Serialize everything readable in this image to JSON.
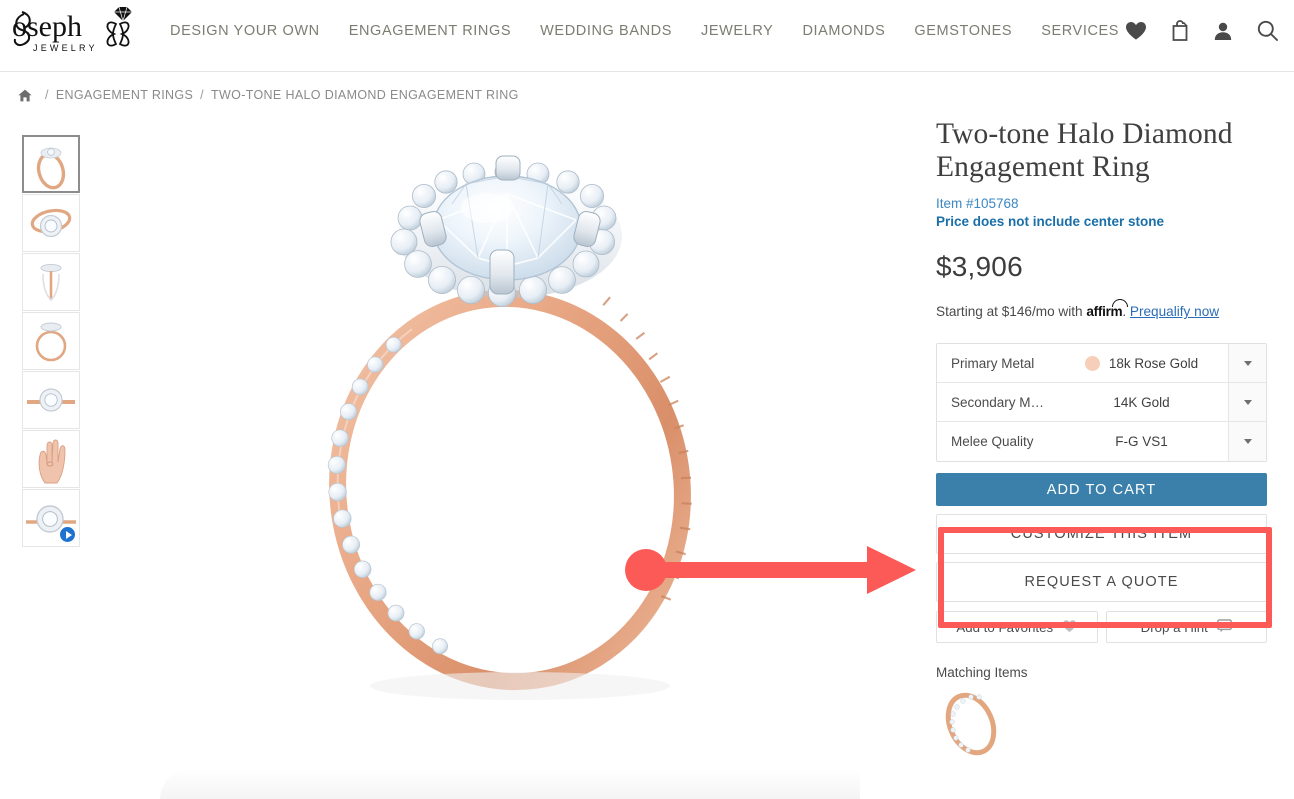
{
  "header": {
    "logo": {
      "name": "Joseph",
      "sub": "J E W E L R Y"
    },
    "nav_items": [
      {
        "label": "DESIGN YOUR OWN",
        "name": "nav-design-your-own"
      },
      {
        "label": "ENGAGEMENT RINGS",
        "name": "nav-engagement-rings"
      },
      {
        "label": "WEDDING BANDS",
        "name": "nav-wedding-bands"
      },
      {
        "label": "JEWELRY",
        "name": "nav-jewelry"
      },
      {
        "label": "DIAMONDS",
        "name": "nav-diamonds"
      },
      {
        "label": "GEMSTONES",
        "name": "nav-gemstones"
      },
      {
        "label": "SERVICES",
        "name": "nav-services"
      }
    ],
    "icons": [
      "heart-icon",
      "bag-icon",
      "account-icon",
      "search-icon"
    ]
  },
  "breadcrumb": {
    "home_icon": "home-icon",
    "separator": "/",
    "items": [
      {
        "label": "ENGAGEMENT RINGS",
        "current": false
      },
      {
        "label": "TWO-TONE HALO DIAMOND ENGAGEMENT RING",
        "current": true
      }
    ]
  },
  "gallery": {
    "thumbnails": [
      {
        "alt": "Ring angled view",
        "active": true,
        "video": false
      },
      {
        "alt": "Ring front tilted view",
        "active": false,
        "video": false
      },
      {
        "alt": "Ring side profile view",
        "active": false,
        "video": false
      },
      {
        "alt": "Ring top down view",
        "active": false,
        "video": false
      },
      {
        "alt": "Ring straight on view",
        "active": false,
        "video": false
      },
      {
        "alt": "Ring on hand model",
        "active": false,
        "video": false
      },
      {
        "alt": "Ring video",
        "active": false,
        "video": true
      }
    ],
    "main_image_alt": "Two-tone halo diamond engagement ring with rose gold pave band"
  },
  "product": {
    "title": "Two-tone Halo Diamond Engagement Ring",
    "item_number": "Item #105768",
    "price_note": "Price does not include center stone",
    "price": "$3,906",
    "financing": {
      "prefix": "Starting at $146/mo with ",
      "brand": "affirm",
      "suffix": ".",
      "link": "Prequalify now"
    },
    "options": [
      {
        "label": "Primary Metal",
        "value": "18k Rose Gold",
        "swatch": "#f7cfb8",
        "has_swatch": true
      },
      {
        "label": "Secondary M…",
        "value": "14K Gold",
        "swatch": "",
        "has_swatch": false
      },
      {
        "label": "Melee Quality",
        "value": "F-G VS1",
        "swatch": "",
        "has_swatch": false
      }
    ],
    "buttons": {
      "add_to_cart": "ADD TO CART",
      "customize": "CUSTOMIZE THIS ITEM",
      "request_quote": "REQUEST A QUOTE",
      "add_to_favorites": "Add to Favorites",
      "drop_a_hint": "Drop a Hint"
    },
    "matching": {
      "label": "Matching Items",
      "items": [
        {
          "alt": "Rose gold diamond eternity band"
        }
      ]
    }
  },
  "annotations": {
    "arrow_color": "#fc5a57",
    "rect_color": "#fc5a57",
    "target": "CUSTOMIZE THIS ITEM / REQUEST A QUOTE buttons"
  },
  "colors": {
    "accent_blue": "#3b80ab",
    "link_blue": "#2b6cb8",
    "nav_text": "#7b7d70",
    "annotation_red": "#fc5a57",
    "rose_gold": "#f7cfb8"
  }
}
